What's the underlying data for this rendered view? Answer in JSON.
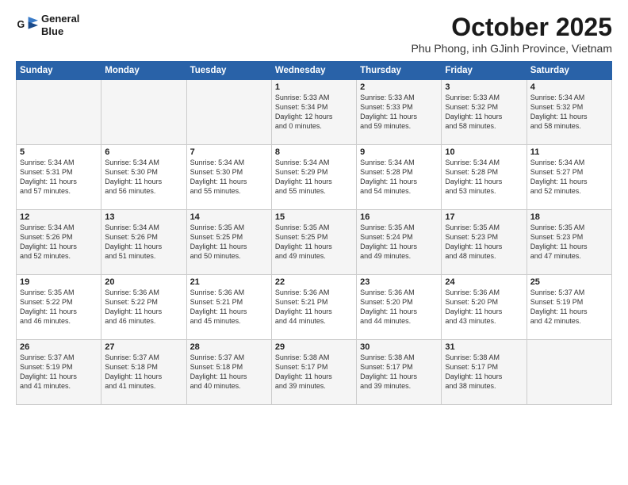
{
  "header": {
    "logo_line1": "General",
    "logo_line2": "Blue",
    "month": "October 2025",
    "location": "Phu Phong, inh GJinh Province, Vietnam"
  },
  "weekdays": [
    "Sunday",
    "Monday",
    "Tuesday",
    "Wednesday",
    "Thursday",
    "Friday",
    "Saturday"
  ],
  "rows": [
    [
      {
        "day": "",
        "info": ""
      },
      {
        "day": "",
        "info": ""
      },
      {
        "day": "",
        "info": ""
      },
      {
        "day": "1",
        "info": "Sunrise: 5:33 AM\nSunset: 5:34 PM\nDaylight: 12 hours\nand 0 minutes."
      },
      {
        "day": "2",
        "info": "Sunrise: 5:33 AM\nSunset: 5:33 PM\nDaylight: 11 hours\nand 59 minutes."
      },
      {
        "day": "3",
        "info": "Sunrise: 5:33 AM\nSunset: 5:32 PM\nDaylight: 11 hours\nand 58 minutes."
      },
      {
        "day": "4",
        "info": "Sunrise: 5:34 AM\nSunset: 5:32 PM\nDaylight: 11 hours\nand 58 minutes."
      }
    ],
    [
      {
        "day": "5",
        "info": "Sunrise: 5:34 AM\nSunset: 5:31 PM\nDaylight: 11 hours\nand 57 minutes."
      },
      {
        "day": "6",
        "info": "Sunrise: 5:34 AM\nSunset: 5:30 PM\nDaylight: 11 hours\nand 56 minutes."
      },
      {
        "day": "7",
        "info": "Sunrise: 5:34 AM\nSunset: 5:30 PM\nDaylight: 11 hours\nand 55 minutes."
      },
      {
        "day": "8",
        "info": "Sunrise: 5:34 AM\nSunset: 5:29 PM\nDaylight: 11 hours\nand 55 minutes."
      },
      {
        "day": "9",
        "info": "Sunrise: 5:34 AM\nSunset: 5:28 PM\nDaylight: 11 hours\nand 54 minutes."
      },
      {
        "day": "10",
        "info": "Sunrise: 5:34 AM\nSunset: 5:28 PM\nDaylight: 11 hours\nand 53 minutes."
      },
      {
        "day": "11",
        "info": "Sunrise: 5:34 AM\nSunset: 5:27 PM\nDaylight: 11 hours\nand 52 minutes."
      }
    ],
    [
      {
        "day": "12",
        "info": "Sunrise: 5:34 AM\nSunset: 5:26 PM\nDaylight: 11 hours\nand 52 minutes."
      },
      {
        "day": "13",
        "info": "Sunrise: 5:34 AM\nSunset: 5:26 PM\nDaylight: 11 hours\nand 51 minutes."
      },
      {
        "day": "14",
        "info": "Sunrise: 5:35 AM\nSunset: 5:25 PM\nDaylight: 11 hours\nand 50 minutes."
      },
      {
        "day": "15",
        "info": "Sunrise: 5:35 AM\nSunset: 5:25 PM\nDaylight: 11 hours\nand 49 minutes."
      },
      {
        "day": "16",
        "info": "Sunrise: 5:35 AM\nSunset: 5:24 PM\nDaylight: 11 hours\nand 49 minutes."
      },
      {
        "day": "17",
        "info": "Sunrise: 5:35 AM\nSunset: 5:23 PM\nDaylight: 11 hours\nand 48 minutes."
      },
      {
        "day": "18",
        "info": "Sunrise: 5:35 AM\nSunset: 5:23 PM\nDaylight: 11 hours\nand 47 minutes."
      }
    ],
    [
      {
        "day": "19",
        "info": "Sunrise: 5:35 AM\nSunset: 5:22 PM\nDaylight: 11 hours\nand 46 minutes."
      },
      {
        "day": "20",
        "info": "Sunrise: 5:36 AM\nSunset: 5:22 PM\nDaylight: 11 hours\nand 46 minutes."
      },
      {
        "day": "21",
        "info": "Sunrise: 5:36 AM\nSunset: 5:21 PM\nDaylight: 11 hours\nand 45 minutes."
      },
      {
        "day": "22",
        "info": "Sunrise: 5:36 AM\nSunset: 5:21 PM\nDaylight: 11 hours\nand 44 minutes."
      },
      {
        "day": "23",
        "info": "Sunrise: 5:36 AM\nSunset: 5:20 PM\nDaylight: 11 hours\nand 44 minutes."
      },
      {
        "day": "24",
        "info": "Sunrise: 5:36 AM\nSunset: 5:20 PM\nDaylight: 11 hours\nand 43 minutes."
      },
      {
        "day": "25",
        "info": "Sunrise: 5:37 AM\nSunset: 5:19 PM\nDaylight: 11 hours\nand 42 minutes."
      }
    ],
    [
      {
        "day": "26",
        "info": "Sunrise: 5:37 AM\nSunset: 5:19 PM\nDaylight: 11 hours\nand 41 minutes."
      },
      {
        "day": "27",
        "info": "Sunrise: 5:37 AM\nSunset: 5:18 PM\nDaylight: 11 hours\nand 41 minutes."
      },
      {
        "day": "28",
        "info": "Sunrise: 5:37 AM\nSunset: 5:18 PM\nDaylight: 11 hours\nand 40 minutes."
      },
      {
        "day": "29",
        "info": "Sunrise: 5:38 AM\nSunset: 5:17 PM\nDaylight: 11 hours\nand 39 minutes."
      },
      {
        "day": "30",
        "info": "Sunrise: 5:38 AM\nSunset: 5:17 PM\nDaylight: 11 hours\nand 39 minutes."
      },
      {
        "day": "31",
        "info": "Sunrise: 5:38 AM\nSunset: 5:17 PM\nDaylight: 11 hours\nand 38 minutes."
      },
      {
        "day": "",
        "info": ""
      }
    ]
  ]
}
